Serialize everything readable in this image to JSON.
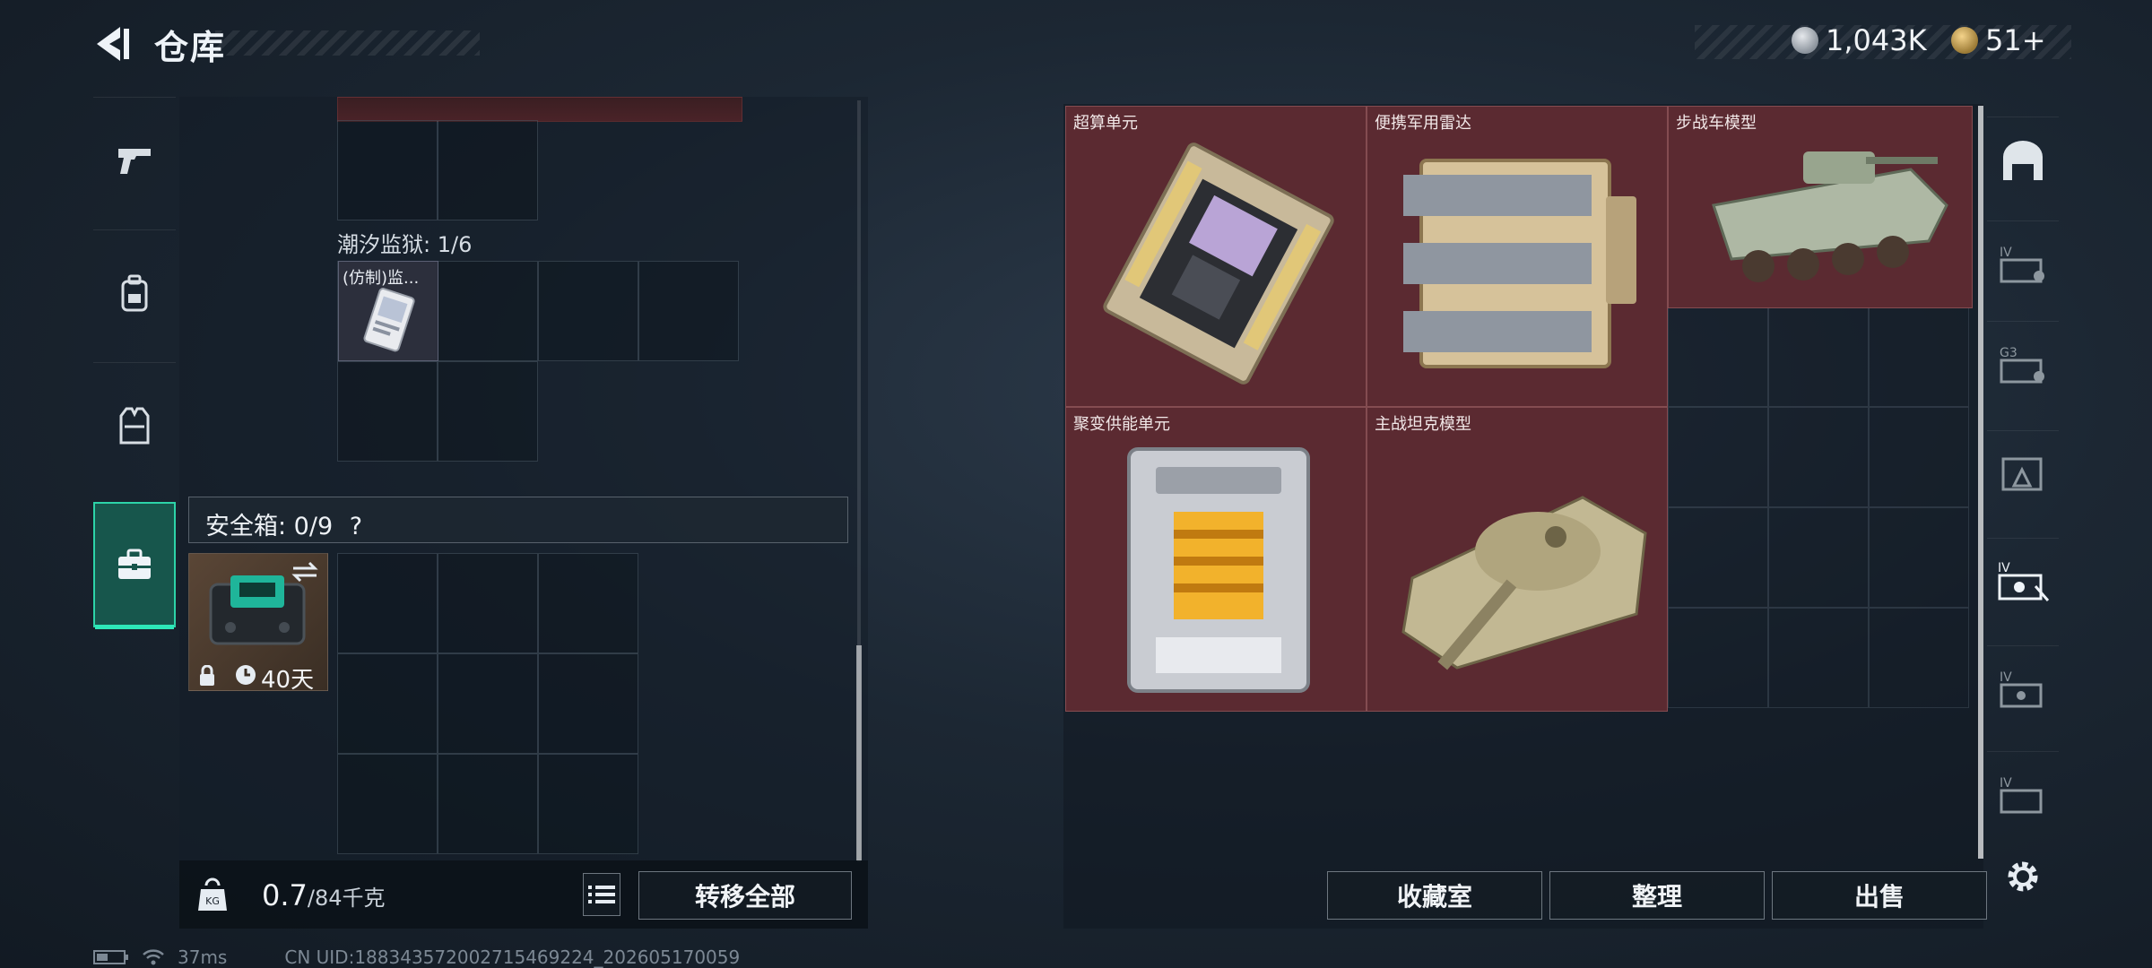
{
  "header": {
    "title": "仓库",
    "currency_silver": "1,043K",
    "currency_gold": "51+"
  },
  "left_nav": [
    {
      "icon": "pistol-icon"
    },
    {
      "icon": "backpack-icon"
    },
    {
      "icon": "vest-icon"
    },
    {
      "icon": "briefcase-icon",
      "active": true
    }
  ],
  "container_section": {
    "label": "潮汐监狱: 1/6",
    "item_label": "(仿制)监..."
  },
  "safe_box": {
    "title": "安全箱: 0/9",
    "help": "?",
    "duration": "40天"
  },
  "bottom_bar": {
    "weight_value": "0.7",
    "weight_max": "/84千克",
    "transfer_all": "转移全部"
  },
  "stash_items": [
    {
      "name": "超算单元"
    },
    {
      "name": "便携军用雷达"
    },
    {
      "name": "步战车模型"
    },
    {
      "name": "聚变供能单元"
    },
    {
      "name": "主战坦克模型"
    }
  ],
  "stash_actions": {
    "collection": "收藏室",
    "organize": "整理",
    "sell": "出售"
  },
  "status": {
    "ping": "37ms",
    "uid": "CN UID:18834357200271546922​4_202605170059"
  },
  "colors": {
    "accent": "#2dd4a8",
    "item_bg": "#5b2a31"
  }
}
